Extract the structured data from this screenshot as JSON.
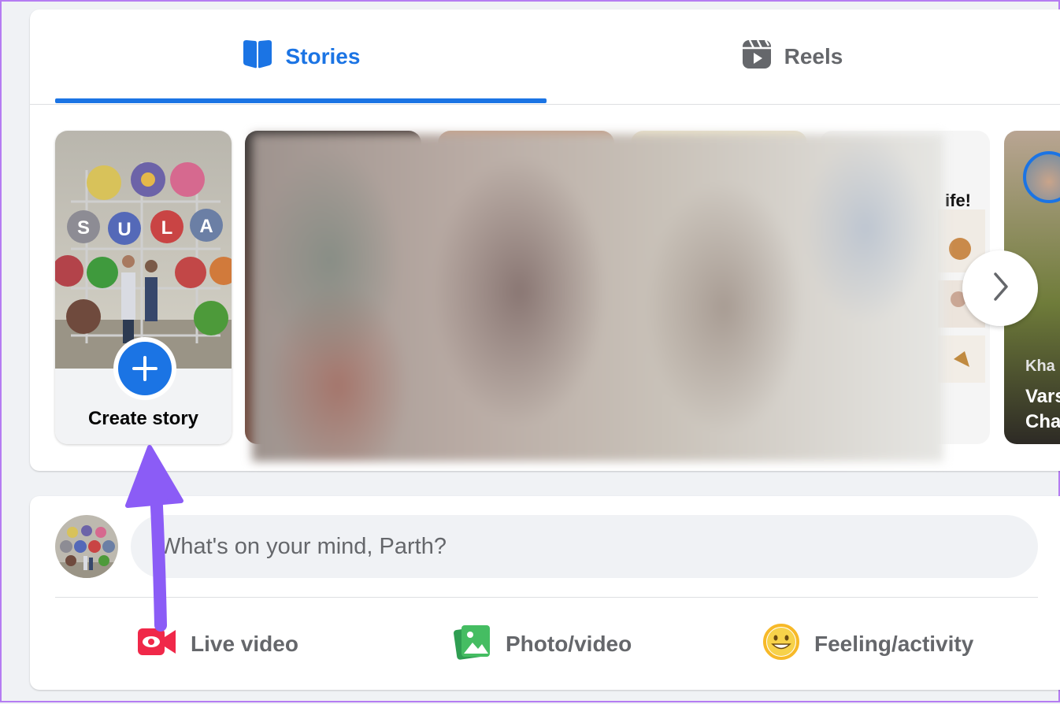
{
  "tabs": [
    {
      "label": "Stories",
      "icon": "book-open-icon",
      "active": true
    },
    {
      "label": "Reels",
      "icon": "reels-play-icon",
      "active": false
    }
  ],
  "stories": {
    "create_label": "Create story",
    "story4_text": "ife!",
    "story5_sub": "Kha",
    "story5_title_line1": "Vars",
    "story5_title_line2": "Cha"
  },
  "composer": {
    "placeholder": "What's on your mind, Parth?"
  },
  "actions": {
    "live": "Live video",
    "photo": "Photo/video",
    "feeling": "Feeling/activity"
  },
  "colors": {
    "accent": "#1b74e4",
    "live": "#f02849",
    "photo": "#45bd62",
    "feeling": "#f7b928",
    "annotation_arrow": "#8b5cf6"
  }
}
